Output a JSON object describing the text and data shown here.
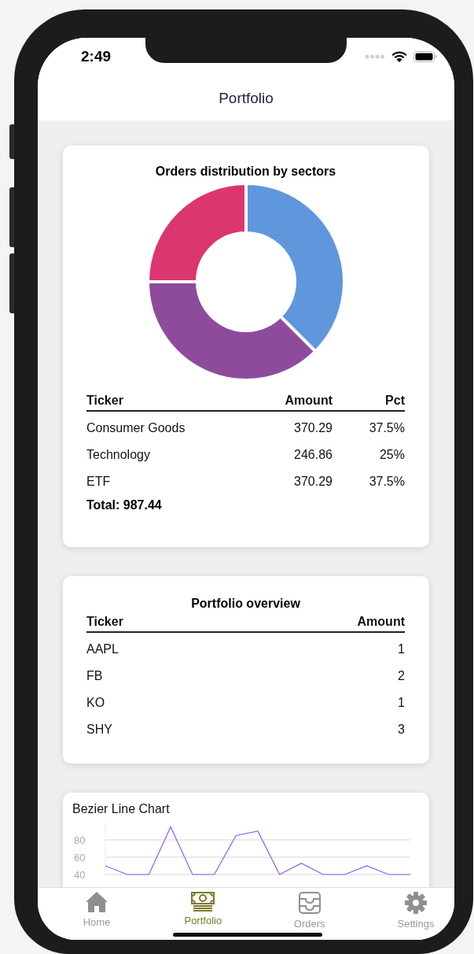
{
  "status_bar": {
    "time": "2:49"
  },
  "nav": {
    "title": "Portfolio"
  },
  "sectors_card": {
    "title": "Orders distribution by sectors",
    "chart_data": {
      "type": "donut",
      "categories": [
        "Consumer Goods",
        "Technology",
        "ETF"
      ],
      "values": [
        37.5,
        25,
        37.5
      ],
      "colors": [
        "#8e4b9c",
        "#dc3670",
        "#6096dc"
      ]
    },
    "columns": [
      "Ticker",
      "Amount",
      "Pct"
    ],
    "rows": [
      {
        "amount": "370.29",
        "pct": "37.5%"
      },
      {
        "amount": "246.86",
        "pct": "25%"
      },
      {
        "amount": "370.29",
        "pct": "37.5%"
      }
    ],
    "total": "Total: 987.44"
  },
  "overview_card": {
    "title": "Portfolio overview",
    "columns": [
      "Ticker",
      "Amount"
    ],
    "rows": [
      {
        "ticker": "AAPL",
        "amount": "1"
      },
      {
        "ticker": "FB",
        "amount": "2"
      },
      {
        "ticker": "KO",
        "amount": "1"
      },
      {
        "ticker": "SHY",
        "amount": "3"
      }
    ]
  },
  "line_card": {
    "title": "Bezier Line Chart",
    "chart_data": {
      "type": "line",
      "ylim": [
        40,
        100
      ],
      "yticks": [
        40,
        60,
        80
      ],
      "series": [
        {
          "color": "#8b5cf6",
          "values": [
            50,
            40,
            40,
            95,
            40,
            40,
            85,
            90,
            40,
            53,
            40,
            40,
            50,
            40,
            40
          ]
        }
      ]
    }
  },
  "tabs": [
    {
      "label": "Home",
      "selected": false
    },
    {
      "label": "Portfolio",
      "selected": true
    },
    {
      "label": "Orders",
      "selected": false
    },
    {
      "label": "Settings",
      "selected": false
    }
  ]
}
